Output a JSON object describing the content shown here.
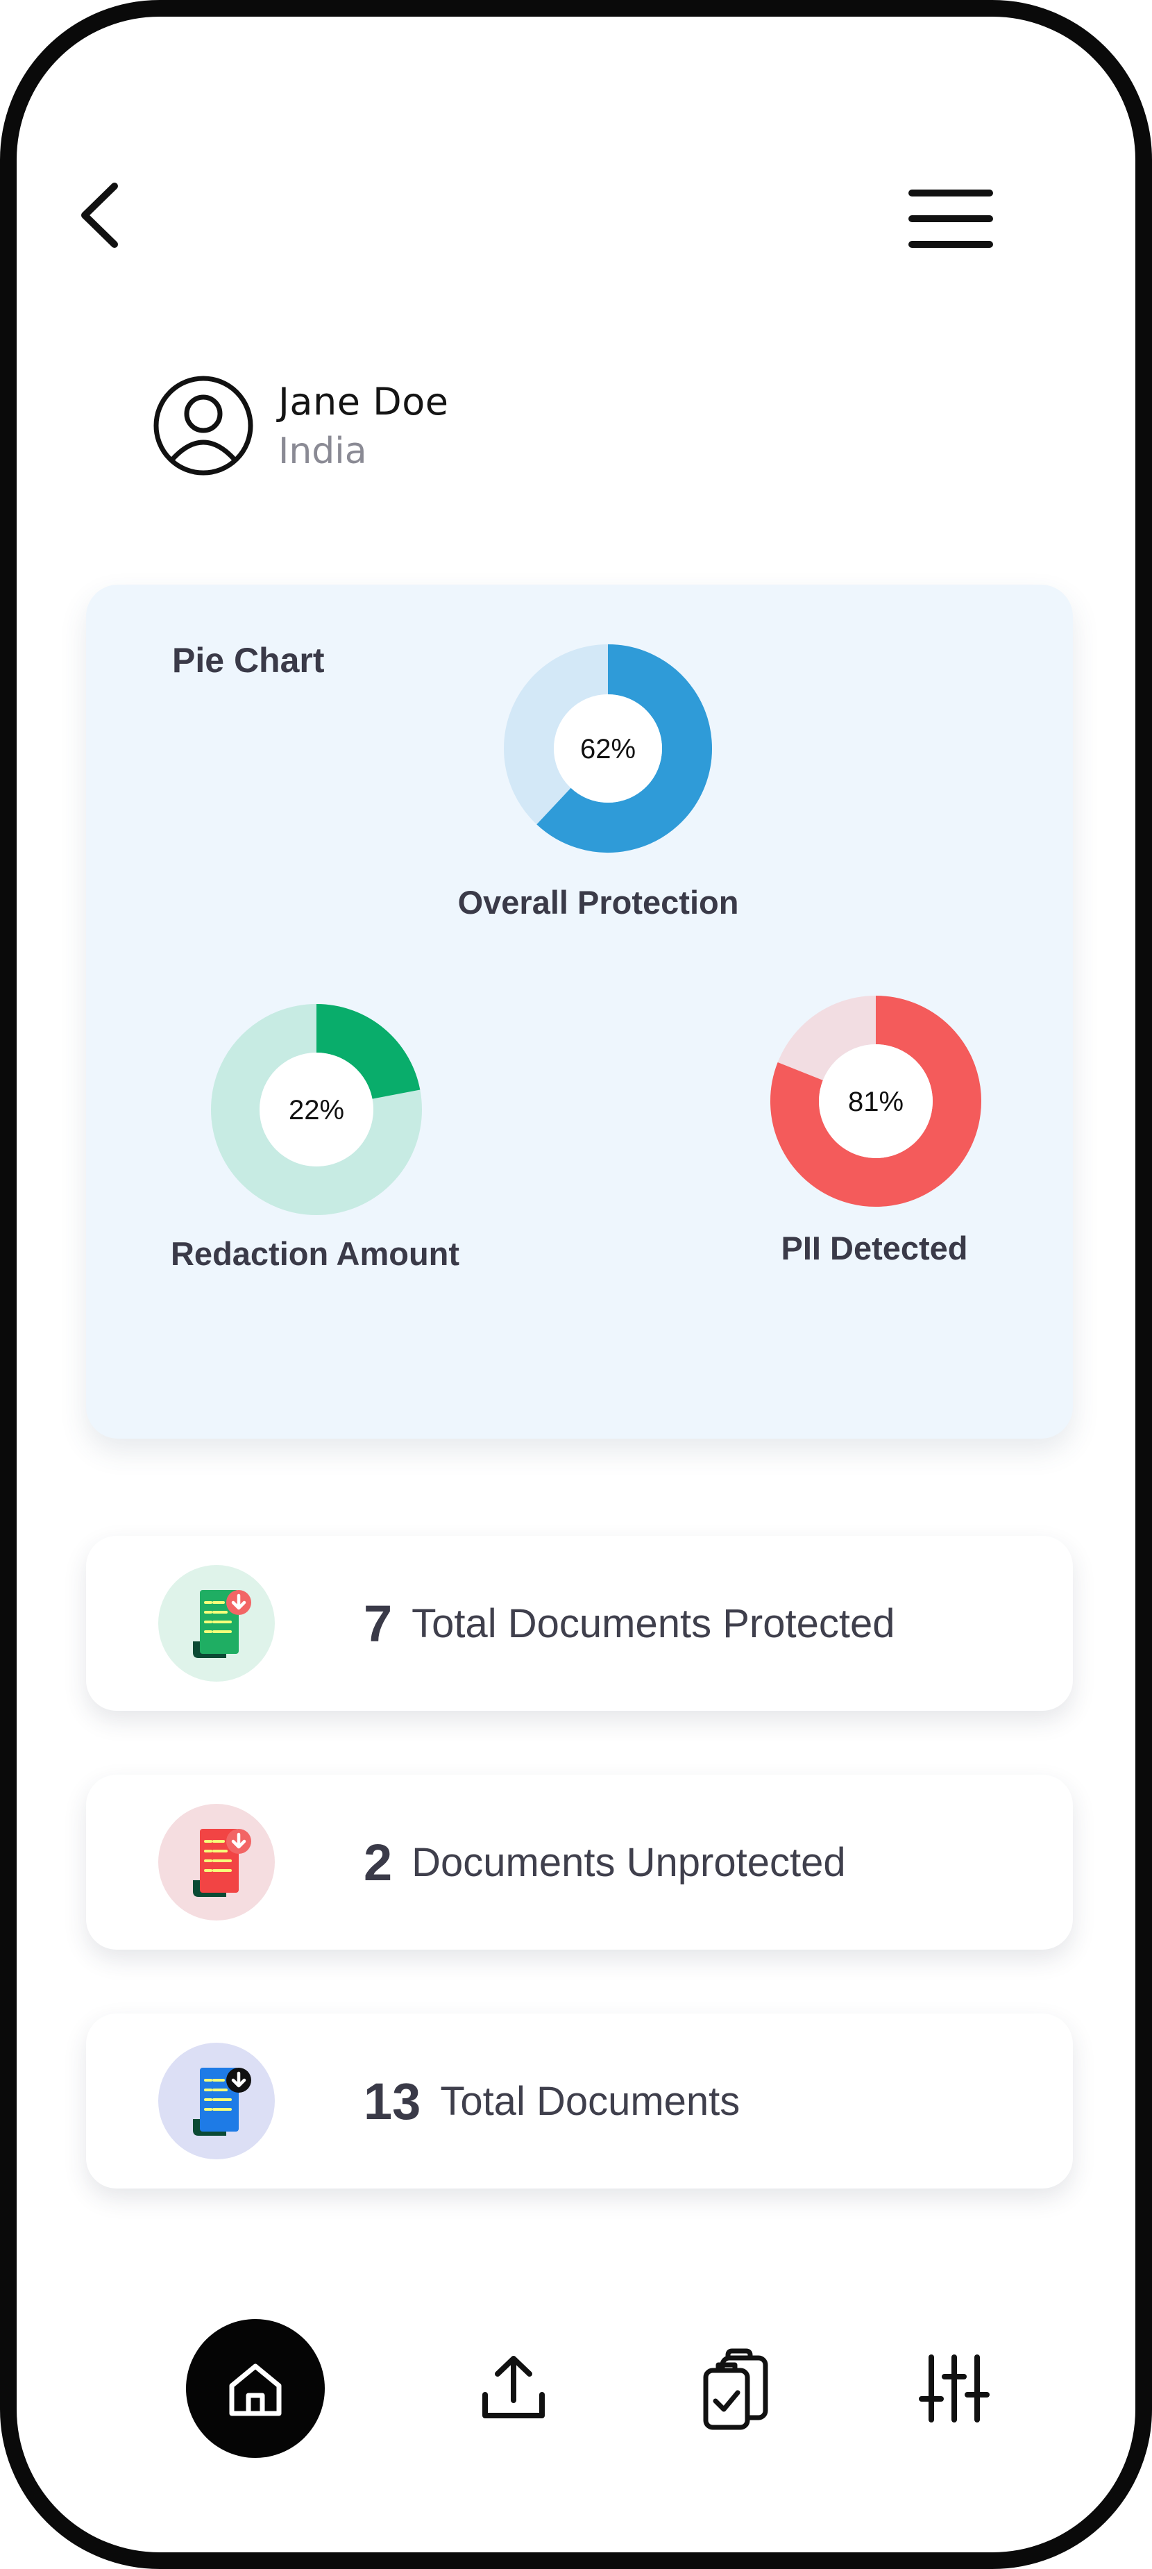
{
  "header": {
    "back_icon": "chevron-left-icon",
    "menu_icon": "hamburger-menu-icon"
  },
  "profile": {
    "name": "Jane Doe",
    "country": "India",
    "avatar_icon": "user-circle-icon"
  },
  "chart_card": {
    "title": "Pie Chart"
  },
  "chart_data": {
    "type": "pie",
    "title": "Pie Chart",
    "charts": [
      {
        "label": "Overall Protection",
        "value": 62,
        "value_label": "62%",
        "color": "#2f9bd8",
        "track_color": "#d3e8f7"
      },
      {
        "label": "Redaction Amount",
        "value": 22,
        "value_label": "22%",
        "color": "#09ad6b",
        "track_color": "#c7ebe3"
      },
      {
        "label": "PII Detected",
        "value": 81,
        "value_label": "81%",
        "color": "#f45b5b",
        "track_color": "#f2dde2"
      }
    ]
  },
  "stats": [
    {
      "number": "7",
      "label": "Total Documents Protected",
      "icon": "document-protected-icon",
      "icon_bg": "#dff3ea",
      "doc_color": "#1fae63",
      "badge_color": "#f26565"
    },
    {
      "number": "2",
      "label": "Documents Unprotected",
      "icon": "document-unprotected-icon",
      "icon_bg": "#f5dde0",
      "doc_color": "#f24444",
      "badge_color": "#f26565"
    },
    {
      "number": "13",
      "label": "Total Documents",
      "icon": "document-total-icon",
      "icon_bg": "#dcdff5",
      "doc_color": "#1e7be6",
      "badge_color": "#111111"
    }
  ],
  "bottom_nav": {
    "items": [
      {
        "icon": "home-icon",
        "active": true
      },
      {
        "icon": "upload-icon",
        "active": false
      },
      {
        "icon": "clipboard-check-icon",
        "active": false
      },
      {
        "icon": "sliders-icon",
        "active": false
      }
    ]
  }
}
